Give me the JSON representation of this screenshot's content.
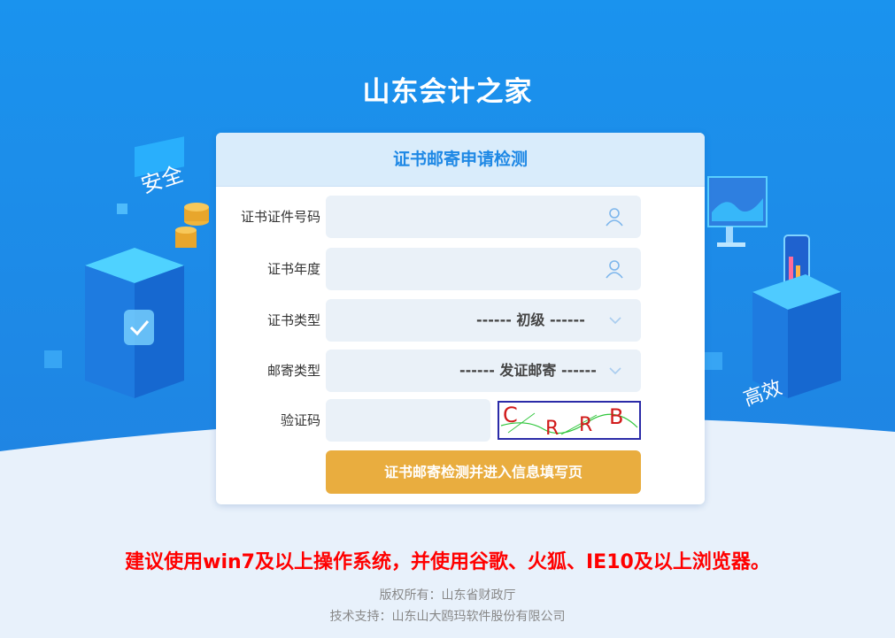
{
  "site_title": "山东会计之家",
  "decorations": {
    "left_tag": "安全",
    "right_tag": "高效"
  },
  "form": {
    "title": "证书邮寄申请检测",
    "fields": [
      {
        "label": "证书证件号码",
        "value": "",
        "icon": "user-icon"
      },
      {
        "label": "证书年度",
        "value": "",
        "icon": "user-icon"
      }
    ],
    "selects": [
      {
        "label": "证书类型",
        "value": "------ 初级 ------"
      },
      {
        "label": "邮寄类型",
        "value": "------ 发证邮寄 ------"
      }
    ],
    "captcha": {
      "label": "验证码",
      "value": "",
      "image_text": "CRRB"
    },
    "submit_label": "证书邮寄检测并进入信息填写页"
  },
  "notice": "建议使用win7及以上操作系统，并使用谷歌、火狐、IE10及以上浏览器。",
  "footer": {
    "copyright": "版权所有：山东省财政厅",
    "support": "技术支持：山东山大鸥玛软件股份有限公司"
  },
  "colors": {
    "background_blue": "#1d8fe8",
    "accent_blue": "#1e88e5",
    "button_orange": "#e9ad3f",
    "notice_red": "#ff0000"
  }
}
